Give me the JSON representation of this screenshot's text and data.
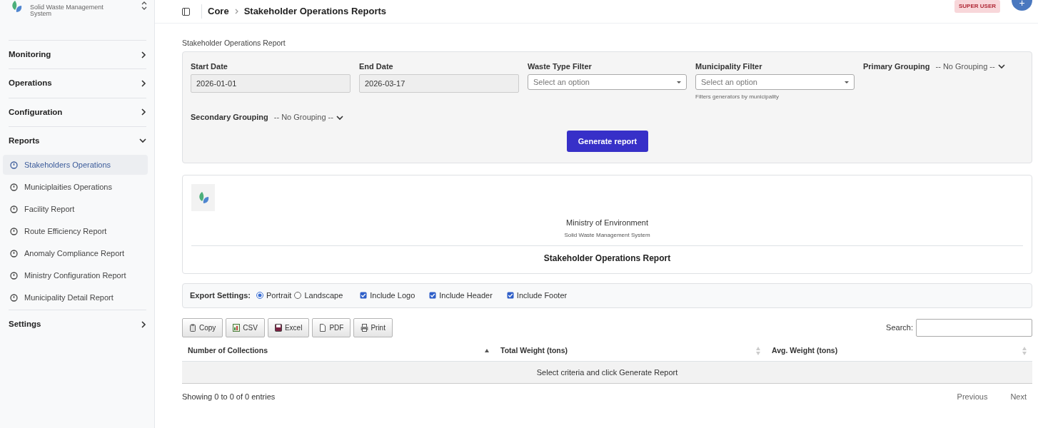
{
  "sidebar": {
    "app_name": "Solid Waste Management System",
    "sections": [
      {
        "label": "Monitoring",
        "expanded": false
      },
      {
        "label": "Operations",
        "expanded": false
      },
      {
        "label": "Configuration",
        "expanded": false
      },
      {
        "label": "Reports",
        "expanded": true,
        "children": [
          {
            "label": "Stakeholders Operations",
            "selected": true
          },
          {
            "label": "Municiplaities Operations",
            "selected": false
          },
          {
            "label": "Facility Report",
            "selected": false
          },
          {
            "label": "Route Efficiency Report",
            "selected": false
          },
          {
            "label": "Anomaly Compliance Report",
            "selected": false
          },
          {
            "label": "Ministry Configuration Report",
            "selected": false
          },
          {
            "label": "Municipality Detail Report",
            "selected": false
          }
        ]
      },
      {
        "label": "Settings",
        "expanded": false
      }
    ]
  },
  "header": {
    "breadcrumb": [
      "Core",
      "Stakeholder Operations Reports"
    ],
    "role_badge": "SUPER USER",
    "add_button": "+"
  },
  "form": {
    "title": "Stakeholder Operations Report",
    "fields": [
      {
        "kind": "date",
        "label": "Start Date",
        "value": "2026-01-01"
      },
      {
        "kind": "date",
        "label": "End Date",
        "value": "2026-03-17"
      },
      {
        "kind": "select",
        "label": "Waste Type Filter",
        "placeholder": "Select an option"
      },
      {
        "kind": "select",
        "label": "Municipality Filter",
        "placeholder": "Select an option",
        "help": "Filters generators by municipality"
      },
      {
        "kind": "grouping",
        "label": "Primary Grouping",
        "value": "-- No Grouping --"
      },
      {
        "kind": "grouping",
        "label": "Secondary Grouping",
        "value": "-- No Grouping --"
      }
    ],
    "button": "Generate report"
  },
  "report_header": {
    "org": "Ministry of Environment",
    "system": "Solid Waste Management System",
    "title": "Stakeholder Operations Report"
  },
  "export_settings": {
    "label": "Export Settings:",
    "orientations": [
      {
        "label": "Portrait",
        "selected": true
      },
      {
        "label": "Landscape",
        "selected": false
      }
    ],
    "options": [
      {
        "label": "Include Logo",
        "checked": true
      },
      {
        "label": "Include Header",
        "checked": true
      },
      {
        "label": "Include Footer",
        "checked": true
      }
    ]
  },
  "table": {
    "buttons": [
      {
        "kind": "copy",
        "label": "Copy"
      },
      {
        "kind": "csv",
        "label": "CSV"
      },
      {
        "kind": "excel",
        "label": "Excel"
      },
      {
        "kind": "pdf",
        "label": "PDF"
      },
      {
        "kind": "print",
        "label": "Print"
      }
    ],
    "search_label": "Search:",
    "columns": [
      {
        "label": "Number of Collections",
        "sorted": true
      },
      {
        "label": "Total Weight (tons)",
        "sorted": false
      },
      {
        "label": "Avg. Weight (tons)",
        "sorted": false
      }
    ],
    "empty_message": "Select criteria and click Generate Report",
    "info": "Showing 0 to 0 of 0 entries",
    "pagination": [
      "Previous",
      "Next"
    ]
  }
}
